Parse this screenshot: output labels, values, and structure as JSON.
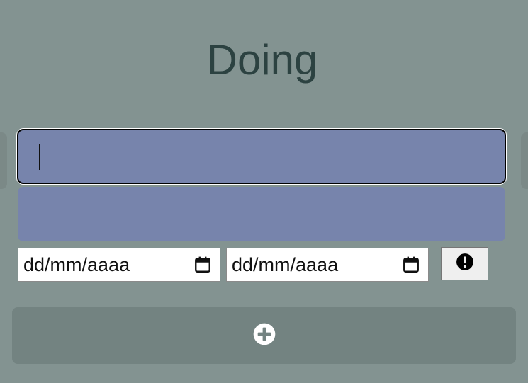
{
  "column": {
    "title": "Doing"
  },
  "form": {
    "title_input": {
      "value": "",
      "placeholder": ""
    },
    "description_input": {
      "value": "",
      "placeholder": ""
    },
    "start_date": {
      "text": "dd/mm/aaaa",
      "icon": "calendar-icon"
    },
    "end_date": {
      "text": "dd/mm/aaaa",
      "icon": "calendar-icon"
    },
    "priority_button": {
      "icon": "exclamation-circle-icon"
    }
  },
  "add_button": {
    "icon": "plus-circle-icon"
  },
  "colors": {
    "background": "#839391",
    "input_fill": "#7784ac",
    "title_text": "#2c4241",
    "add_button_fill": "#738381"
  }
}
